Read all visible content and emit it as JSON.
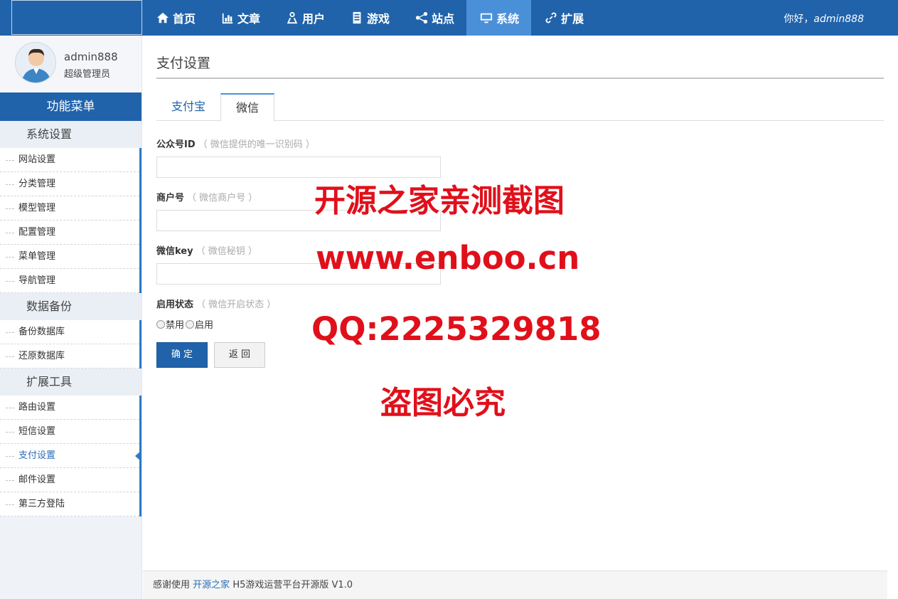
{
  "header": {
    "nav": [
      {
        "label": "首页",
        "icon": "home-icon"
      },
      {
        "label": "文章",
        "icon": "bar-chart-icon"
      },
      {
        "label": "用户",
        "icon": "user-icon"
      },
      {
        "label": "游戏",
        "icon": "document-icon"
      },
      {
        "label": "站点",
        "icon": "share-icon"
      },
      {
        "label": "系统",
        "icon": "monitor-icon",
        "active": true
      },
      {
        "label": "扩展",
        "icon": "link-icon"
      }
    ],
    "greeting_prefix": "你好，",
    "greeting_user": "admin888"
  },
  "sidebar": {
    "profile_name": "admin888",
    "profile_role": "超级管理员",
    "menu_title": "功能菜单",
    "groups": [
      {
        "title": "系统设置",
        "items": [
          "网站设置",
          "分类管理",
          "模型管理",
          "配置管理",
          "菜单管理",
          "导航管理"
        ]
      },
      {
        "title": "数据备份",
        "items": [
          "备份数据库",
          "还原数据库"
        ]
      },
      {
        "title": "扩展工具",
        "items": [
          "路由设置",
          "短信设置",
          "支付设置",
          "邮件设置",
          "第三方登陆"
        ]
      }
    ],
    "active_item": "支付设置"
  },
  "main": {
    "page_title": "支付设置",
    "tabs": [
      {
        "label": "支付宝",
        "active": false
      },
      {
        "label": "微信",
        "active": true
      }
    ],
    "fields": [
      {
        "label": "公众号ID",
        "hint": "（ 微信提供的唯一识别码 ）",
        "value": ""
      },
      {
        "label": "商户号",
        "hint": "（ 微信商户号 ）",
        "value": ""
      },
      {
        "label": "微信key",
        "hint": "（ 微信秘钥 ）",
        "value": ""
      }
    ],
    "status": {
      "label": "启用状态",
      "hint": "（ 微信开启状态 ）",
      "options": [
        "禁用",
        "启用"
      ]
    },
    "ok_button": "确 定",
    "back_button": "返 回"
  },
  "watermark": {
    "line1": "开源之家亲测截图",
    "line2": "www.enboo.cn",
    "line3": "QQ:2225329818",
    "line4": "盗图必究",
    "color": "#e0101b"
  },
  "footer": {
    "prefix": "感谢使用",
    "link": "开源之家",
    "suffix": "H5游戏运营平台开源版 V1.0"
  },
  "colors": {
    "primary": "#2063ab",
    "nav_active": "#4a90d9"
  }
}
